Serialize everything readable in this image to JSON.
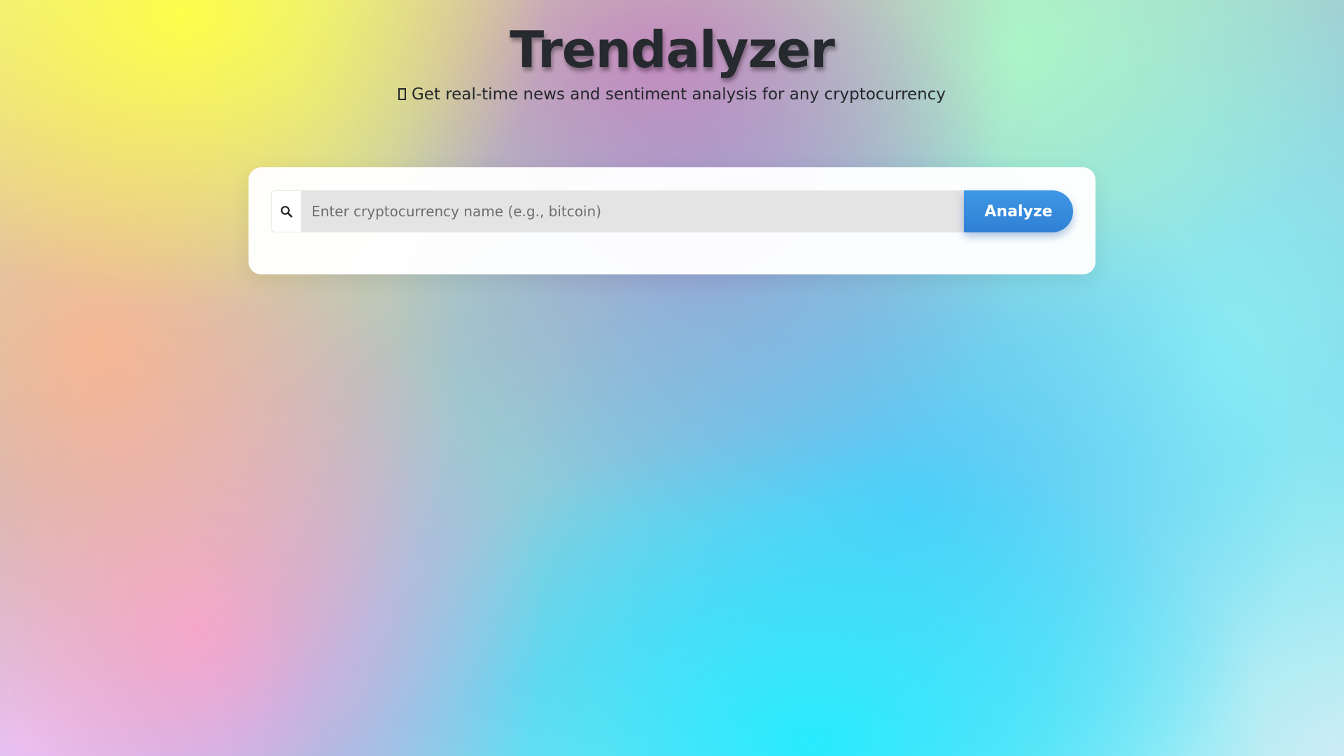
{
  "header": {
    "title": "Trendalyzer",
    "subtitle": "Get real-time news and sentiment analysis for any cryptocurrency",
    "subtitle_icon": "missing-glyph-icon"
  },
  "search": {
    "icon": "search-icon",
    "placeholder": "Enter cryptocurrency name (e.g., bitcoin)",
    "value": "",
    "button_label": "Analyze"
  },
  "colors": {
    "title": "#262a2e",
    "button": "#3a8fdf",
    "card": "#ffffff",
    "input_bg": "#e4e4e4"
  }
}
